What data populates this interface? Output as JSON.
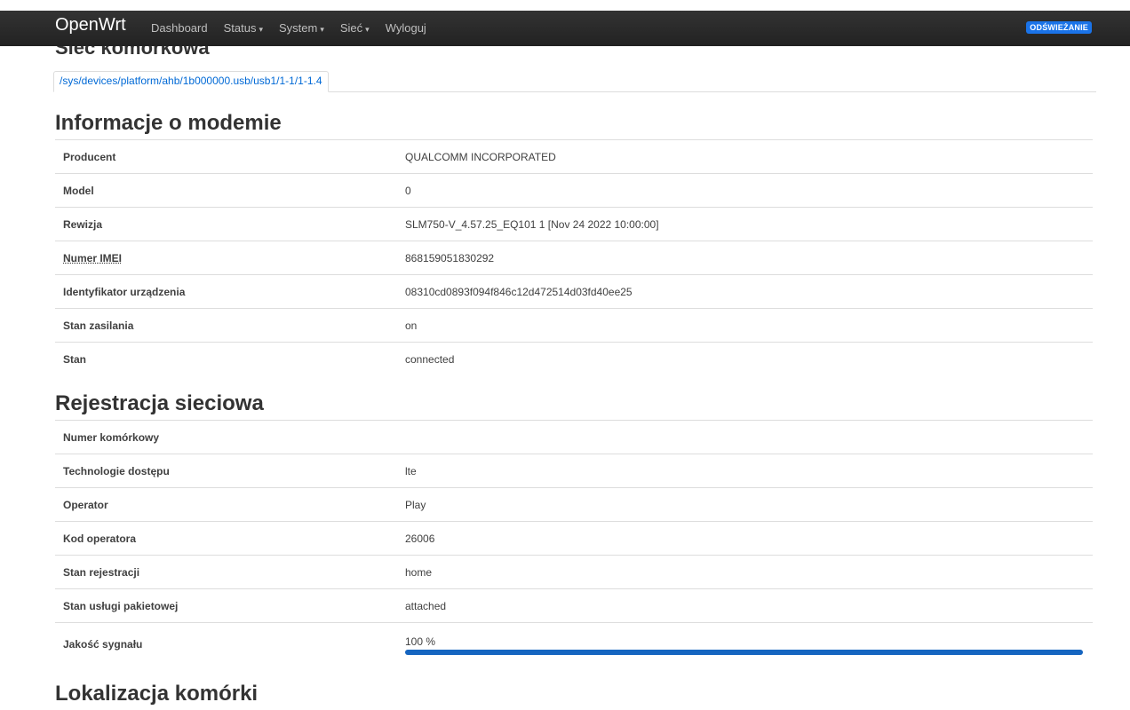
{
  "navbar": {
    "brand": "OpenWrt",
    "items": [
      {
        "label": "Dashboard",
        "has_dropdown": false
      },
      {
        "label": "Status",
        "has_dropdown": true
      },
      {
        "label": "System",
        "has_dropdown": true
      },
      {
        "label": "Sieć",
        "has_dropdown": true
      },
      {
        "label": "Wyloguj",
        "has_dropdown": false
      }
    ],
    "refresh_label": "ODŚWIEŻANIE"
  },
  "page": {
    "title": "Sieć komórkowa",
    "tab_label": "/sys/devices/platform/ahb/1b000000.usb/usb1/1-1/1-1.4"
  },
  "modem_info": {
    "heading": "Informacje o modemie",
    "rows": [
      {
        "key": "Producent",
        "value": "QUALCOMM INCORPORATED"
      },
      {
        "key": "Model",
        "value": "0"
      },
      {
        "key": "Rewizja",
        "value": "SLM750-V_4.57.25_EQ101 1 [Nov 24 2022 10:00:00]"
      },
      {
        "key": "Numer IMEI",
        "value": "868159051830292"
      },
      {
        "key": "Identyfikator urządzenia",
        "value": "08310cd0893f094f846c12d472514d03fd40ee25"
      },
      {
        "key": "Stan zasilania",
        "value": "on"
      },
      {
        "key": "Stan",
        "value": "connected"
      }
    ]
  },
  "registration": {
    "heading": "Rejestracja sieciowa",
    "rows": [
      {
        "key": "Numer komórkowy",
        "value": ""
      },
      {
        "key": "Technologie dostępu",
        "value": "lte"
      },
      {
        "key": "Operator",
        "value": "Play"
      },
      {
        "key": "Kod operatora",
        "value": "26006"
      },
      {
        "key": "Stan rejestracji",
        "value": "home"
      },
      {
        "key": "Stan usługi pakietowej",
        "value": "attached"
      }
    ],
    "signal": {
      "key": "Jakość sygnału",
      "text": "100 %",
      "percent": 100,
      "bar_color": "#1565c0"
    }
  },
  "cell_location": {
    "heading": "Lokalizacja komórki"
  },
  "colors": {
    "accent": "#1a73e8",
    "navbar": "#222222",
    "link": "#0069d6"
  }
}
